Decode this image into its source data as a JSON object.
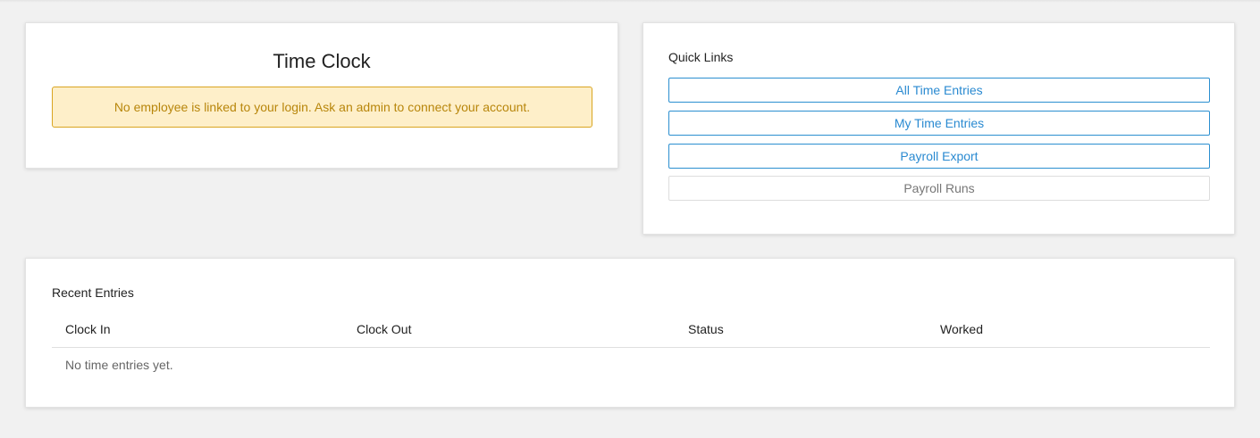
{
  "time_clock": {
    "title": "Time Clock",
    "alert_message": "No employee is linked to your login. Ask an admin to connect your account."
  },
  "quick_links": {
    "heading": "Quick Links",
    "buttons": [
      {
        "label": "All Time Entries",
        "enabled": true
      },
      {
        "label": "My Time Entries",
        "enabled": true
      },
      {
        "label": "Payroll Export",
        "enabled": true
      },
      {
        "label": "Payroll Runs",
        "enabled": false
      }
    ]
  },
  "recent_entries": {
    "heading": "Recent Entries",
    "columns": [
      "Clock In",
      "Clock Out",
      "Status",
      "Worked"
    ],
    "empty_message": "No time entries yet."
  },
  "colors": {
    "page_background": "#f1f1f1",
    "alert_background": "#feefc9",
    "alert_border": "#d9a521",
    "alert_text": "#b8860b",
    "link_blue": "#2a8ad1"
  }
}
